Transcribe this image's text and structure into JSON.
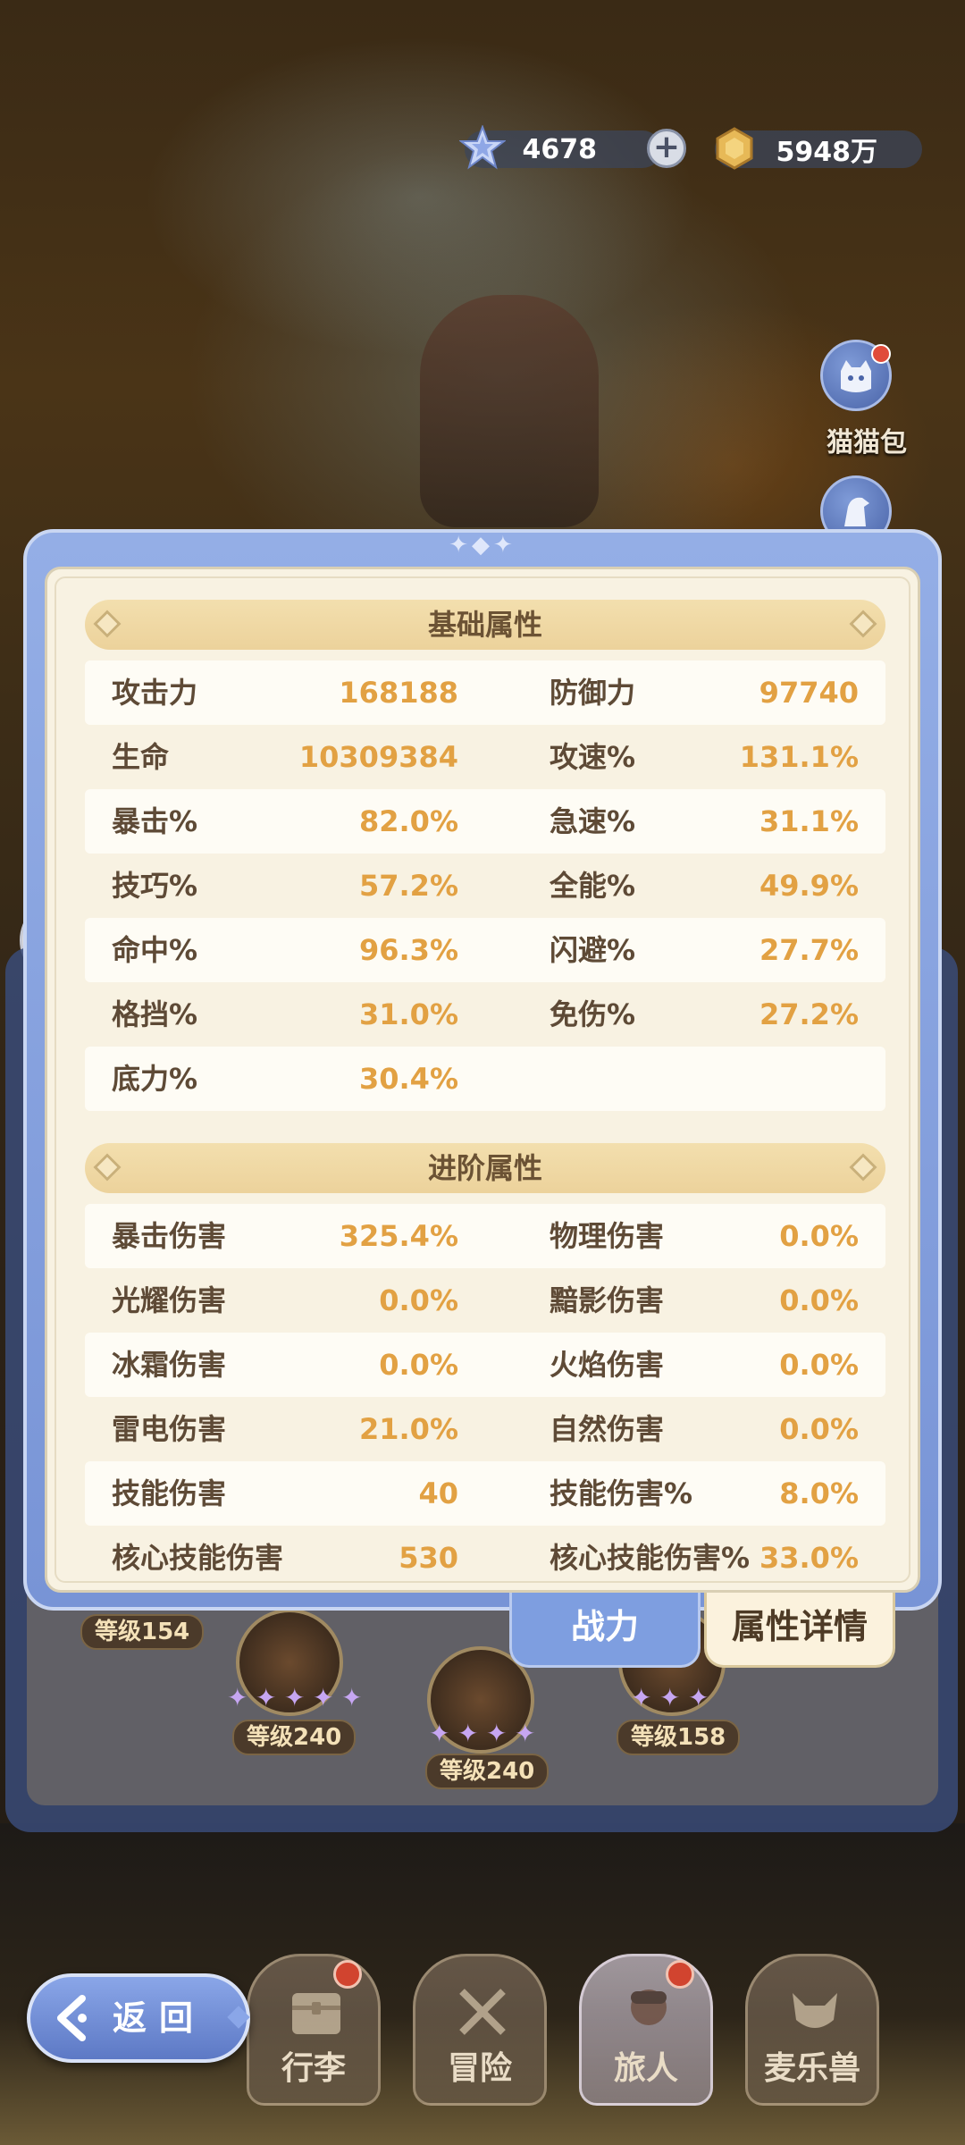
{
  "currency": {
    "gems": "4678",
    "gold": "5948万"
  },
  "side": {
    "bag_label": "猫猫包"
  },
  "modal": {
    "basic_title": "基础属性",
    "advanced_title": "进阶属性",
    "basic_rows": [
      {
        "l_label": "攻击力",
        "l_value": "168188",
        "r_label": "防御力",
        "r_value": "97740"
      },
      {
        "l_label": "生命",
        "l_value": "10309384",
        "r_label": "攻速%",
        "r_value": "131.1%"
      },
      {
        "l_label": "暴击%",
        "l_value": "82.0%",
        "r_label": "急速%",
        "r_value": "31.1%"
      },
      {
        "l_label": "技巧%",
        "l_value": "57.2%",
        "r_label": "全能%",
        "r_value": "49.9%"
      },
      {
        "l_label": "命中%",
        "l_value": "96.3%",
        "r_label": "闪避%",
        "r_value": "27.7%"
      },
      {
        "l_label": "格挡%",
        "l_value": "31.0%",
        "r_label": "免伤%",
        "r_value": "27.2%"
      },
      {
        "l_label": "底力%",
        "l_value": "30.4%",
        "r_label": "",
        "r_value": ""
      }
    ],
    "advanced_rows": [
      {
        "l_label": "暴击伤害",
        "l_value": "325.4%",
        "r_label": "物理伤害",
        "r_value": "0.0%"
      },
      {
        "l_label": "光耀伤害",
        "l_value": "0.0%",
        "r_label": "黯影伤害",
        "r_value": "0.0%"
      },
      {
        "l_label": "冰霜伤害",
        "l_value": "0.0%",
        "r_label": "火焰伤害",
        "r_value": "0.0%"
      },
      {
        "l_label": "雷电伤害",
        "l_value": "21.0%",
        "r_label": "自然伤害",
        "r_value": "0.0%"
      },
      {
        "l_label": "技能伤害",
        "l_value": "40",
        "r_label": "技能伤害%",
        "r_value": "8.0%"
      },
      {
        "l_label": "核心技能伤害",
        "l_value": "530",
        "r_label": "核心技能伤害%",
        "r_value": "33.0%"
      }
    ]
  },
  "tabs": {
    "power": "战力",
    "details": "属性详情"
  },
  "team": {
    "levels": [
      "等级154",
      "等级240",
      "等级240",
      "等级158"
    ]
  },
  "nav": {
    "back": "返回",
    "items": [
      "行李",
      "冒险",
      "旅人",
      "麦乐兽"
    ]
  },
  "colors": {
    "accent_blue": "#7e9ee0",
    "value_orange": "#e2a143",
    "label_brown": "#5e4a36",
    "paper": "#f8f2e2"
  }
}
